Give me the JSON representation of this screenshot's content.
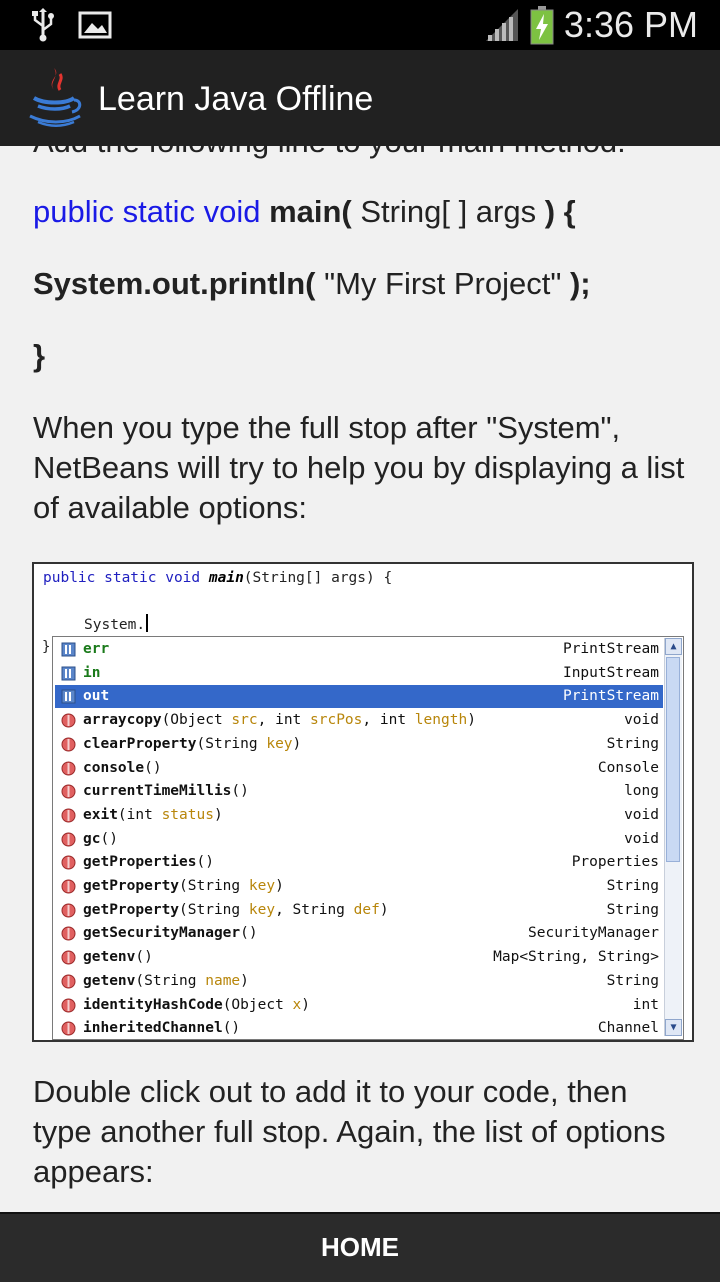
{
  "status_bar": {
    "time": "3:36 PM",
    "icons": [
      "usb-icon",
      "image-icon",
      "signal-icon",
      "battery-charging-icon"
    ],
    "battery_color": "#7dc242"
  },
  "app_bar": {
    "title": "Learn Java Offline",
    "logo": "java-logo-icon"
  },
  "content": {
    "cut_line": "Add the following line to your main method:",
    "code_line1": {
      "kw": "public static void",
      "method": "main(",
      "params": " String[ ] args ",
      "end": ") {"
    },
    "code_line2": {
      "call": "System.out.println(",
      "arg": " \"My First Project\" ",
      "end": ");"
    },
    "code_line3": "}",
    "para1": "When you type the full stop after \"System\", NetBeans will try to help you by displaying a list of available options:",
    "para2": "Double click out to add it to your code, then type another full stop. Again, the list of options appears:"
  },
  "screenshot": {
    "code1_kw": "public static void",
    "code1_method": "main",
    "code1_rest": "(String[] args) {",
    "code2": "System.",
    "bracket": "}",
    "rows": [
      {
        "name": "err",
        "args": "",
        "ret": "PrintStream",
        "kind": "field"
      },
      {
        "name": "in",
        "args": "",
        "ret": "InputStream",
        "kind": "field"
      },
      {
        "name": "out",
        "args": "",
        "ret": "PrintStream",
        "kind": "field",
        "selected": true
      },
      {
        "name": "arraycopy",
        "pre": "(Object ",
        "p1": "src",
        "mid": ", int ",
        "p2": "srcPos",
        "mid2": ",        int ",
        "p3": "length",
        "post": ")",
        "ret": "void",
        "kind": "method"
      },
      {
        "name": "clearProperty",
        "pre": "(String ",
        "p1": "key",
        "post": ")",
        "ret": "String",
        "kind": "method"
      },
      {
        "name": "console",
        "pre": "()",
        "ret": "Console",
        "kind": "method"
      },
      {
        "name": "currentTimeMillis",
        "pre": "()",
        "ret": "long",
        "kind": "method"
      },
      {
        "name": "exit",
        "pre": "(int ",
        "p1": "status",
        "post": ")",
        "ret": "void",
        "kind": "method"
      },
      {
        "name": "gc",
        "pre": "()",
        "ret": "void",
        "kind": "method"
      },
      {
        "name": "getProperties",
        "pre": "()",
        "ret": "Properties",
        "kind": "method"
      },
      {
        "name": "getProperty",
        "pre": "(String ",
        "p1": "key",
        "post": ")",
        "ret": "String",
        "kind": "method"
      },
      {
        "name": "getProperty",
        "pre": "(String ",
        "p1": "key",
        "mid": ", String ",
        "p2": "def",
        "post": ")",
        "ret": "String",
        "kind": "method"
      },
      {
        "name": "getSecurityManager",
        "pre": "()",
        "ret": "SecurityManager",
        "kind": "method"
      },
      {
        "name": "getenv",
        "pre": "()",
        "ret": "Map<String, String>",
        "kind": "method"
      },
      {
        "name": "getenv",
        "pre": "(String ",
        "p1": "name",
        "post": ")",
        "ret": "String",
        "kind": "method"
      },
      {
        "name": "identityHashCode",
        "pre": "(Object ",
        "p1": "x",
        "post": ")",
        "ret": "int",
        "kind": "method"
      },
      {
        "name": "inheritedChannel",
        "pre": "()",
        "ret": "Channel",
        "kind": "method"
      }
    ]
  },
  "bottom_bar": {
    "home_label": "HOME"
  }
}
